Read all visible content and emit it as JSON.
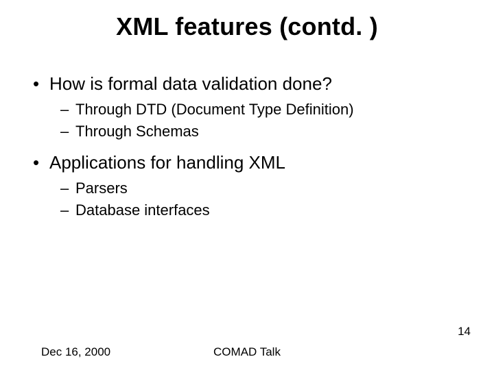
{
  "title": "XML features (contd. )",
  "bullets": [
    {
      "text": "How is formal data validation done?",
      "sub": [
        "Through DTD (Document Type Definition)",
        "Through Schemas"
      ]
    },
    {
      "text": "Applications for handling XML",
      "sub": [
        "Parsers",
        "Database interfaces"
      ]
    }
  ],
  "footer": {
    "date": "Dec 16, 2000",
    "center": "COMAD Talk",
    "page": "14"
  }
}
